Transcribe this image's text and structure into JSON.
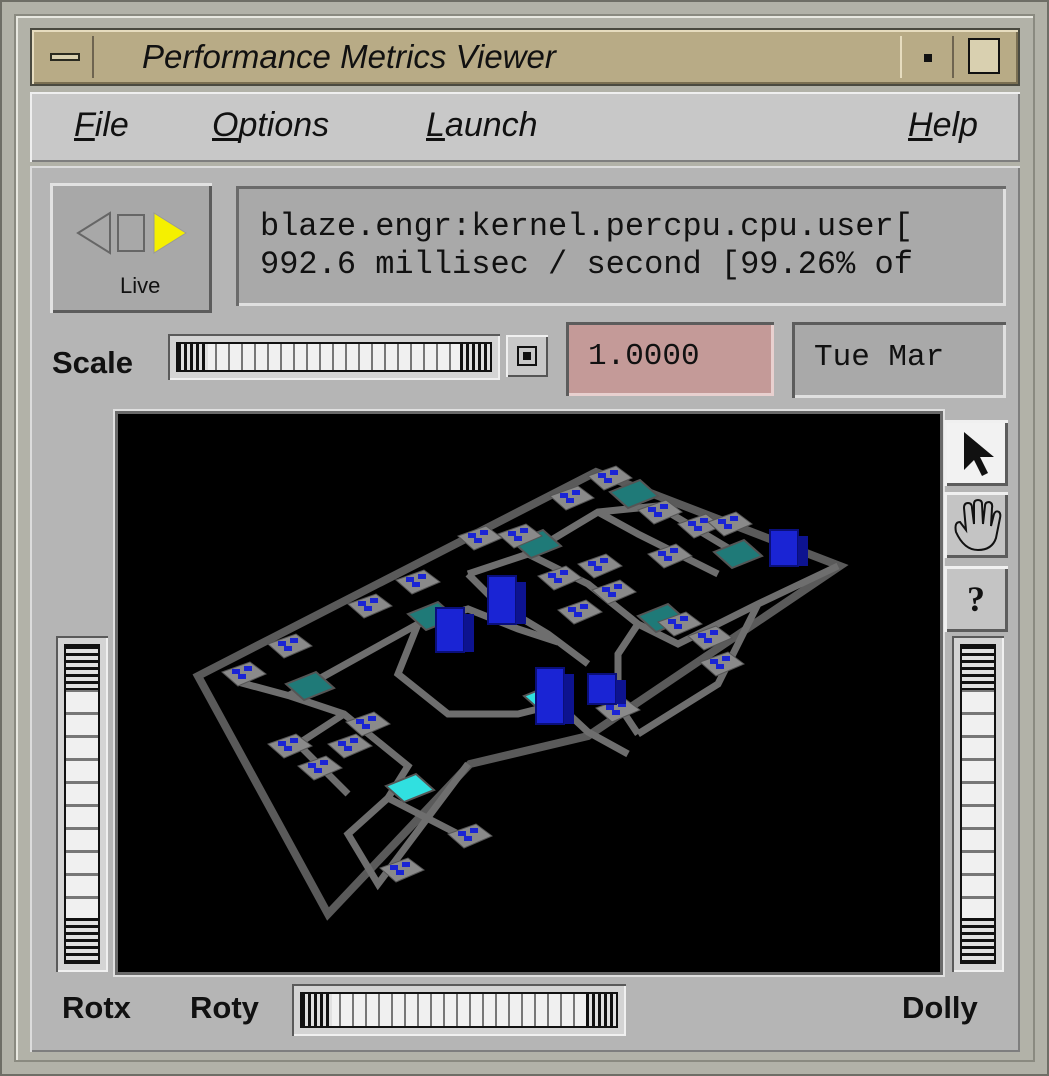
{
  "window": {
    "title": "Performance Metrics Viewer"
  },
  "menubar": {
    "items": [
      {
        "label": "File",
        "mnemonic": "F",
        "rest": "ile"
      },
      {
        "label": "Options",
        "mnemonic": "O",
        "rest": "ptions"
      },
      {
        "label": "Launch",
        "mnemonic": "L",
        "rest": "aunch"
      },
      {
        "label": "Help",
        "mnemonic": "H",
        "rest": "elp"
      }
    ]
  },
  "time_control": {
    "mode_label": "Live",
    "icons": [
      "step-back-icon",
      "stop-icon",
      "play-icon"
    ],
    "play_color": "#f5f000"
  },
  "metric_info": {
    "line1": "blaze.engr:kernel.percpu.cpu.user[",
    "line2": "992.6 millisec / second [99.26% of"
  },
  "scale": {
    "label": "Scale",
    "value": "1.0000",
    "date": "Tue Mar"
  },
  "viewport": {
    "background": "#000000",
    "tools": [
      "pointer-icon",
      "hand-icon",
      "help-icon"
    ],
    "help_label": "?",
    "colors": {
      "base": "#6e6e6e",
      "bar": "#1a24d4",
      "router_active": "#30e0e0",
      "router_idle": "#1f7a78"
    }
  },
  "bottom": {
    "rotx": "Rotx",
    "roty": "Roty",
    "dolly": "Dolly"
  }
}
